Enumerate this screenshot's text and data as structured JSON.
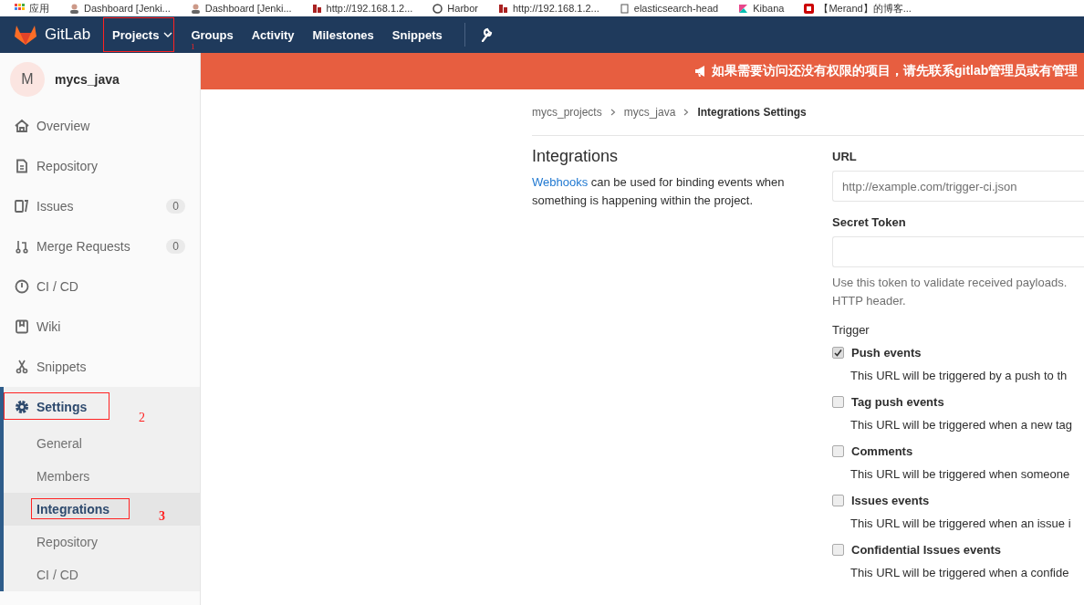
{
  "bookmarks": [
    {
      "label": "应用",
      "kind": "apps"
    },
    {
      "label": "Dashboard [Jenki...",
      "kind": "person"
    },
    {
      "label": "Dashboard [Jenki...",
      "kind": "person"
    },
    {
      "label": "http://192.168.1.2...",
      "kind": "page"
    },
    {
      "label": "Harbor",
      "kind": "circle"
    },
    {
      "label": "http://192.168.1.2...",
      "kind": "page"
    },
    {
      "label": "elasticsearch-head",
      "kind": "doc"
    },
    {
      "label": "Kibana",
      "kind": "kibana"
    },
    {
      "label": "【Merand】的博客...",
      "kind": "blog"
    }
  ],
  "navbar": {
    "brand": "GitLab",
    "items": [
      {
        "label": "Projects",
        "dropdown": true,
        "marked": true,
        "mark_label": "1"
      },
      {
        "label": "Groups",
        "dropdown": false,
        "marked": false
      },
      {
        "label": "Activity",
        "dropdown": false,
        "marked": false
      },
      {
        "label": "Milestones",
        "dropdown": false,
        "marked": false
      },
      {
        "label": "Snippets",
        "dropdown": false,
        "marked": false
      }
    ]
  },
  "sidebar": {
    "avatar": "M",
    "project": "mycs_java",
    "items": [
      {
        "label": "Overview",
        "kind": "home"
      },
      {
        "label": "Repository",
        "kind": "repo"
      },
      {
        "label": "Issues",
        "kind": "issues",
        "count": "0"
      },
      {
        "label": "Merge Requests",
        "kind": "merge",
        "count": "0"
      },
      {
        "label": "CI / CD",
        "kind": "ci"
      },
      {
        "label": "Wiki",
        "kind": "wiki"
      },
      {
        "label": "Snippets",
        "kind": "snippets"
      },
      {
        "label": "Settings",
        "kind": "settings",
        "expanded": true,
        "marked": true,
        "mark_label": "2",
        "children": [
          {
            "label": "General",
            "selected": false,
            "marked": false
          },
          {
            "label": "Members",
            "selected": false,
            "marked": false
          },
          {
            "label": "Integrations",
            "selected": true,
            "marked": true,
            "mark_label": "3"
          },
          {
            "label": "Repository",
            "selected": false,
            "marked": false
          },
          {
            "label": "CI / CD",
            "selected": false,
            "marked": false
          }
        ]
      }
    ]
  },
  "banner": "如果需要访问还没有权限的项目，请先联系gitlab管理员或有管理",
  "breadcrumbs": [
    "mycs_projects",
    "mycs_java",
    "Integrations Settings"
  ],
  "intro": {
    "title": "Integrations",
    "link": "Webhooks",
    "text": " can be used for binding events when something is happening within the project."
  },
  "form": {
    "url": {
      "label": "URL",
      "placeholder": "http://example.com/trigger-ci.json"
    },
    "token": {
      "label": "Secret Token",
      "help": [
        "Use this token to validate received payloads.",
        "HTTP header."
      ]
    },
    "trigger_label": "Trigger",
    "triggers": [
      {
        "label": "Push events",
        "checked": true,
        "help": "This URL will be triggered by a push to th"
      },
      {
        "label": "Tag push events",
        "checked": false,
        "help": "This URL will be triggered when a new tag"
      },
      {
        "label": "Comments",
        "checked": false,
        "help": "This URL will be triggered when someone"
      },
      {
        "label": "Issues events",
        "checked": false,
        "help": "This URL will be triggered when an issue i"
      },
      {
        "label": "Confidential Issues events",
        "checked": false,
        "help": "This URL will be triggered when a confide"
      }
    ]
  }
}
